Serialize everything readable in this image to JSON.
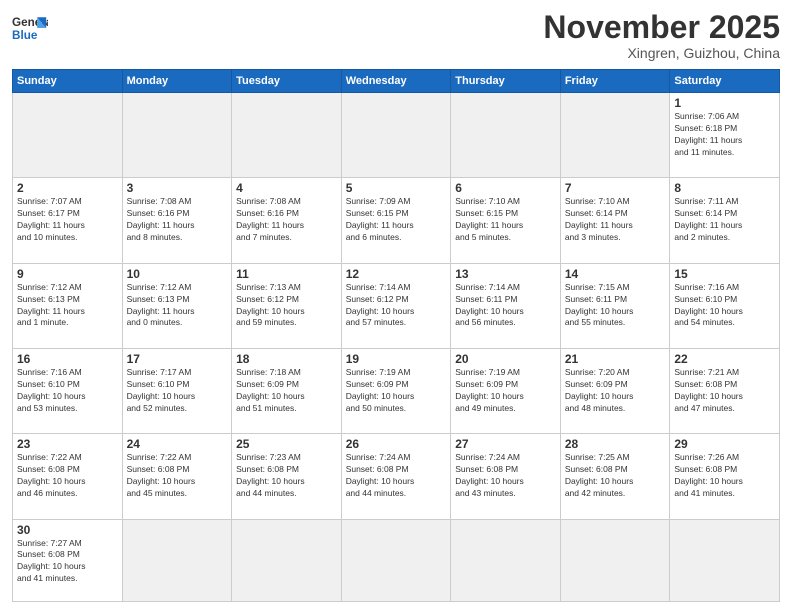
{
  "header": {
    "logo_general": "General",
    "logo_blue": "Blue",
    "month": "November 2025",
    "location": "Xingren, Guizhou, China"
  },
  "days_of_week": [
    "Sunday",
    "Monday",
    "Tuesday",
    "Wednesday",
    "Thursday",
    "Friday",
    "Saturday"
  ],
  "weeks": [
    [
      {
        "day": "",
        "info": ""
      },
      {
        "day": "",
        "info": ""
      },
      {
        "day": "",
        "info": ""
      },
      {
        "day": "",
        "info": ""
      },
      {
        "day": "",
        "info": ""
      },
      {
        "day": "",
        "info": ""
      },
      {
        "day": "1",
        "info": "Sunrise: 7:06 AM\nSunset: 6:18 PM\nDaylight: 11 hours\nand 11 minutes."
      }
    ],
    [
      {
        "day": "2",
        "info": "Sunrise: 7:07 AM\nSunset: 6:17 PM\nDaylight: 11 hours\nand 10 minutes."
      },
      {
        "day": "3",
        "info": "Sunrise: 7:08 AM\nSunset: 6:16 PM\nDaylight: 11 hours\nand 8 minutes."
      },
      {
        "day": "4",
        "info": "Sunrise: 7:08 AM\nSunset: 6:16 PM\nDaylight: 11 hours\nand 7 minutes."
      },
      {
        "day": "5",
        "info": "Sunrise: 7:09 AM\nSunset: 6:15 PM\nDaylight: 11 hours\nand 6 minutes."
      },
      {
        "day": "6",
        "info": "Sunrise: 7:10 AM\nSunset: 6:15 PM\nDaylight: 11 hours\nand 5 minutes."
      },
      {
        "day": "7",
        "info": "Sunrise: 7:10 AM\nSunset: 6:14 PM\nDaylight: 11 hours\nand 3 minutes."
      },
      {
        "day": "8",
        "info": "Sunrise: 7:11 AM\nSunset: 6:14 PM\nDaylight: 11 hours\nand 2 minutes."
      }
    ],
    [
      {
        "day": "9",
        "info": "Sunrise: 7:12 AM\nSunset: 6:13 PM\nDaylight: 11 hours\nand 1 minute."
      },
      {
        "day": "10",
        "info": "Sunrise: 7:12 AM\nSunset: 6:13 PM\nDaylight: 11 hours\nand 0 minutes."
      },
      {
        "day": "11",
        "info": "Sunrise: 7:13 AM\nSunset: 6:12 PM\nDaylight: 10 hours\nand 59 minutes."
      },
      {
        "day": "12",
        "info": "Sunrise: 7:14 AM\nSunset: 6:12 PM\nDaylight: 10 hours\nand 57 minutes."
      },
      {
        "day": "13",
        "info": "Sunrise: 7:14 AM\nSunset: 6:11 PM\nDaylight: 10 hours\nand 56 minutes."
      },
      {
        "day": "14",
        "info": "Sunrise: 7:15 AM\nSunset: 6:11 PM\nDaylight: 10 hours\nand 55 minutes."
      },
      {
        "day": "15",
        "info": "Sunrise: 7:16 AM\nSunset: 6:10 PM\nDaylight: 10 hours\nand 54 minutes."
      }
    ],
    [
      {
        "day": "16",
        "info": "Sunrise: 7:16 AM\nSunset: 6:10 PM\nDaylight: 10 hours\nand 53 minutes."
      },
      {
        "day": "17",
        "info": "Sunrise: 7:17 AM\nSunset: 6:10 PM\nDaylight: 10 hours\nand 52 minutes."
      },
      {
        "day": "18",
        "info": "Sunrise: 7:18 AM\nSunset: 6:09 PM\nDaylight: 10 hours\nand 51 minutes."
      },
      {
        "day": "19",
        "info": "Sunrise: 7:19 AM\nSunset: 6:09 PM\nDaylight: 10 hours\nand 50 minutes."
      },
      {
        "day": "20",
        "info": "Sunrise: 7:19 AM\nSunset: 6:09 PM\nDaylight: 10 hours\nand 49 minutes."
      },
      {
        "day": "21",
        "info": "Sunrise: 7:20 AM\nSunset: 6:09 PM\nDaylight: 10 hours\nand 48 minutes."
      },
      {
        "day": "22",
        "info": "Sunrise: 7:21 AM\nSunset: 6:08 PM\nDaylight: 10 hours\nand 47 minutes."
      }
    ],
    [
      {
        "day": "23",
        "info": "Sunrise: 7:22 AM\nSunset: 6:08 PM\nDaylight: 10 hours\nand 46 minutes."
      },
      {
        "day": "24",
        "info": "Sunrise: 7:22 AM\nSunset: 6:08 PM\nDaylight: 10 hours\nand 45 minutes."
      },
      {
        "day": "25",
        "info": "Sunrise: 7:23 AM\nSunset: 6:08 PM\nDaylight: 10 hours\nand 44 minutes."
      },
      {
        "day": "26",
        "info": "Sunrise: 7:24 AM\nSunset: 6:08 PM\nDaylight: 10 hours\nand 44 minutes."
      },
      {
        "day": "27",
        "info": "Sunrise: 7:24 AM\nSunset: 6:08 PM\nDaylight: 10 hours\nand 43 minutes."
      },
      {
        "day": "28",
        "info": "Sunrise: 7:25 AM\nSunset: 6:08 PM\nDaylight: 10 hours\nand 42 minutes."
      },
      {
        "day": "29",
        "info": "Sunrise: 7:26 AM\nSunset: 6:08 PM\nDaylight: 10 hours\nand 41 minutes."
      }
    ],
    [
      {
        "day": "30",
        "info": "Sunrise: 7:27 AM\nSunset: 6:08 PM\nDaylight: 10 hours\nand 41 minutes."
      },
      {
        "day": "",
        "info": ""
      },
      {
        "day": "",
        "info": ""
      },
      {
        "day": "",
        "info": ""
      },
      {
        "day": "",
        "info": ""
      },
      {
        "day": "",
        "info": ""
      },
      {
        "day": "",
        "info": ""
      }
    ]
  ]
}
